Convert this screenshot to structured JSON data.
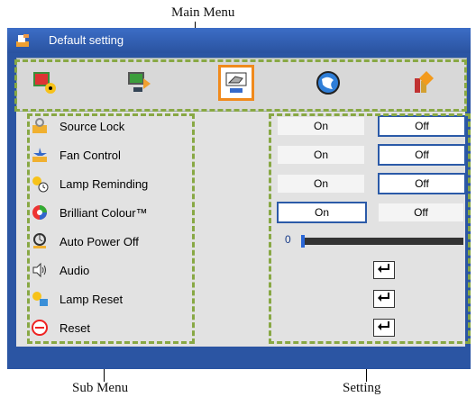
{
  "callouts": {
    "main_menu": "Main Menu",
    "sub_menu": "Sub Menu",
    "setting": "Setting"
  },
  "window": {
    "title": "Default setting",
    "icon": "settings-wrench-icon"
  },
  "main_menu": {
    "items": [
      {
        "icon": "image-settings-icon"
      },
      {
        "icon": "display-settings-icon"
      },
      {
        "icon": "setup-hand-icon",
        "selected": true
      },
      {
        "icon": "globe-language-icon"
      },
      {
        "icon": "options-house-icon"
      }
    ]
  },
  "sub_menu": {
    "items": [
      {
        "label": "Source Lock",
        "icon": "source-lock-icon"
      },
      {
        "label": "Fan Control",
        "icon": "fan-control-icon"
      },
      {
        "label": "Lamp Reminding",
        "icon": "lamp-reminding-icon"
      },
      {
        "label": "Brilliant Colour™",
        "icon": "brilliant-colour-icon"
      },
      {
        "label": "Auto Power Off",
        "icon": "auto-power-off-icon"
      },
      {
        "label": "Audio",
        "icon": "audio-speaker-icon"
      },
      {
        "label": "Lamp Reset",
        "icon": "lamp-reset-icon"
      },
      {
        "label": "Reset",
        "icon": "reset-icon"
      }
    ]
  },
  "settings": {
    "source_lock": {
      "on": "On",
      "off": "Off",
      "selected": "Off"
    },
    "fan_control": {
      "on": "On",
      "off": "Off",
      "selected": "Off"
    },
    "lamp_reminding": {
      "on": "On",
      "off": "Off",
      "selected": "Off"
    },
    "brilliant_colour": {
      "on": "On",
      "off": "Off",
      "selected": "On"
    },
    "auto_power_off": {
      "value": "0"
    },
    "audio": {
      "icon": "enter-icon"
    },
    "lamp_reset": {
      "icon": "enter-icon"
    },
    "reset": {
      "icon": "enter-icon"
    }
  },
  "colors": {
    "osd_blue": "#2b55a3",
    "select_orange": "#f08a1c",
    "dashed_green": "#88a844",
    "selected_border": "#2b5aa8"
  }
}
